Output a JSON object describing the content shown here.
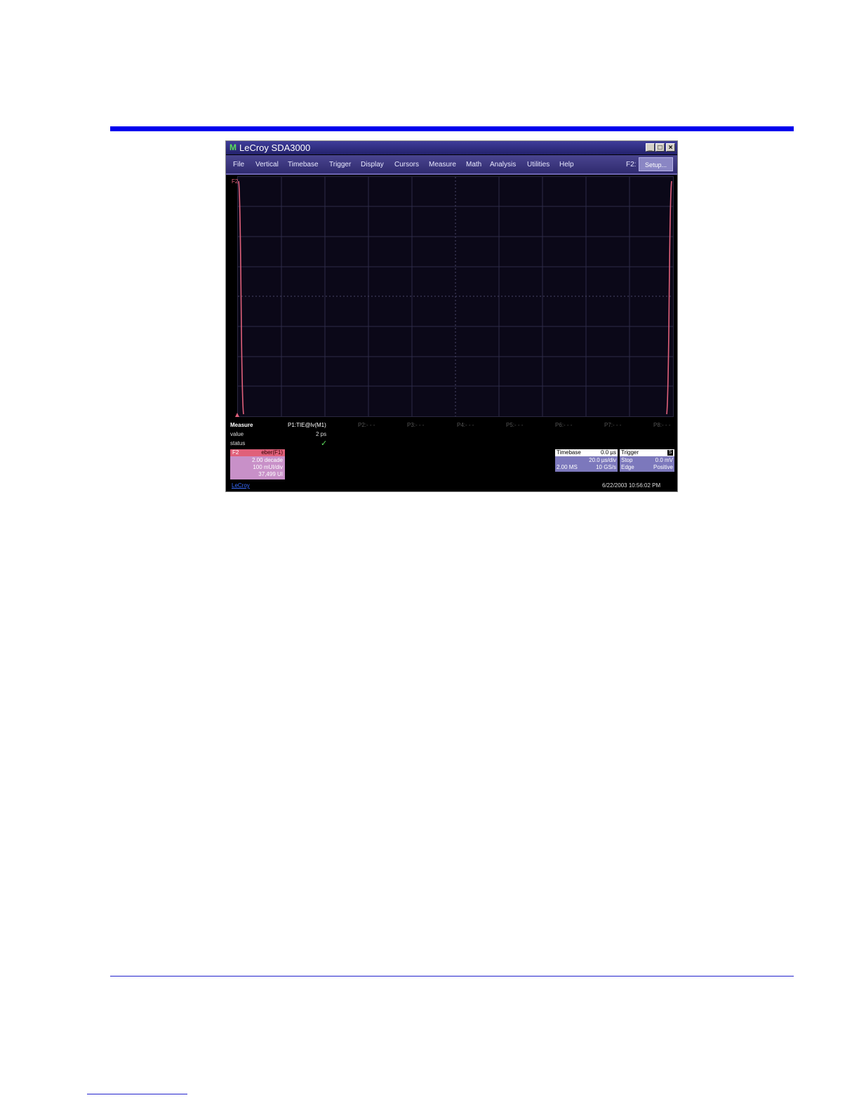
{
  "window": {
    "logo": "M",
    "title": "LeCroy SDA3000"
  },
  "title_buttons": {
    "minimize": "_",
    "maximize": "□",
    "close": "×"
  },
  "menu": [
    "File",
    "Vertical",
    "Timebase",
    "Trigger",
    "Display",
    "Cursors",
    "Measure",
    "Math",
    "Analysis",
    "Utilities",
    "Help"
  ],
  "setup": {
    "label": "F2:",
    "button": "Setup..."
  },
  "trace": {
    "label": "F2",
    "color": "#e0607a"
  },
  "measure": {
    "title": "Measure",
    "row_value": "value",
    "row_status": "status",
    "p1": {
      "name": "P1:TIE@lv(M1)",
      "value": "2 ps",
      "status": "✓"
    },
    "params": [
      "P2:- - -",
      "P3:- - -",
      "P4:- - -",
      "P5:- - -",
      "P6:- - -",
      "P7:- - -",
      "P8:- - -"
    ]
  },
  "f2_box": {
    "name": "F2",
    "func": "eber(F1)",
    "line1": "2.00 decade",
    "line2": "100 mUI/div",
    "line3": "37,499 UI"
  },
  "timebase": {
    "label": "Timebase",
    "delay": "0.0 µs",
    "per_div": "20.0 µs/div",
    "samples": "2.00 MS",
    "rate": "10 GS/s"
  },
  "trigger": {
    "label": "Trigger",
    "ch_icon": "S",
    "mode": "Stop",
    "level": "0.0 mV",
    "type": "Edge",
    "slope": "Positive"
  },
  "status_bar": {
    "brand": "LeCroy",
    "datetime": "6/22/2003 10:56:02 PM"
  },
  "colors": {
    "accent_blue": "#0000ee",
    "trace": "#e0607a",
    "panel_timebase": "#7c78bc",
    "panel_f2": "#c890c8"
  }
}
